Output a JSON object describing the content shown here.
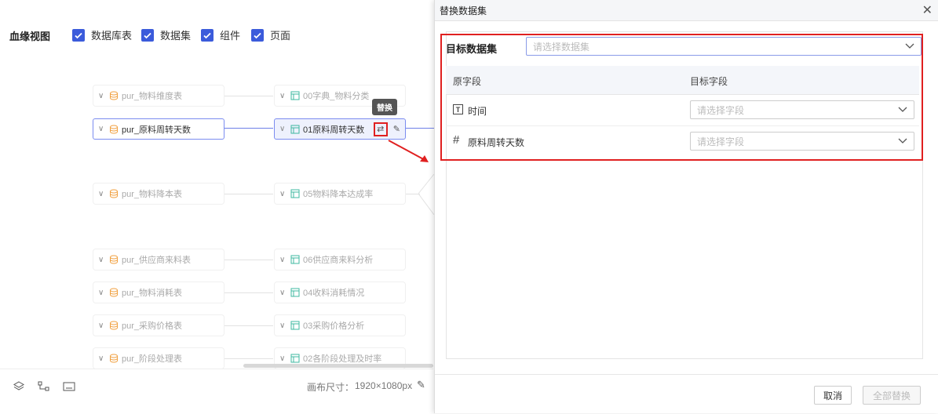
{
  "toolbar": {
    "title": "血缘视图",
    "checkboxes": [
      {
        "label": "数据库表",
        "checked": true
      },
      {
        "label": "数据集",
        "checked": true
      },
      {
        "label": "组件",
        "checked": true
      },
      {
        "label": "页面",
        "checked": true
      }
    ]
  },
  "lineage": {
    "tables": [
      "pur_物料维度表",
      "pur_原料周转天数",
      "pur_物料降本表",
      "pur_供应商来料表",
      "pur_物料消耗表",
      "pur_采购价格表",
      "pur_阶段处理表"
    ],
    "datasets": [
      "00字典_物料分类",
      "01原料周转天数",
      "05物料降本达成率",
      "06供应商来料分析",
      "04收料消耗情况",
      "03采购价格分析",
      "02各阶段处理及时率"
    ],
    "tooltip": "替换"
  },
  "bottom_bar": {
    "canvas_size_label": "画布尺寸：",
    "canvas_size_value": "1920×1080px"
  },
  "dialog": {
    "title": "替换数据集",
    "target_dataset_label": "目标数据集",
    "target_dataset_placeholder": "请选择数据集",
    "columns": {
      "source": "原字段",
      "target": "目标字段"
    },
    "rows": [
      {
        "icon": "text-type-icon",
        "field": "时间",
        "placeholder": "请选择字段"
      },
      {
        "icon": "number-type-icon",
        "field": "原料周转天数",
        "placeholder": "请选择字段"
      }
    ],
    "cancel_label": "取消",
    "replace_all_label": "全部替换"
  },
  "colors": {
    "accent": "#3b5bdb",
    "highlight": "#e02020",
    "db_icon": "#f0a040",
    "dataset_icon": "#3fb8a0"
  }
}
